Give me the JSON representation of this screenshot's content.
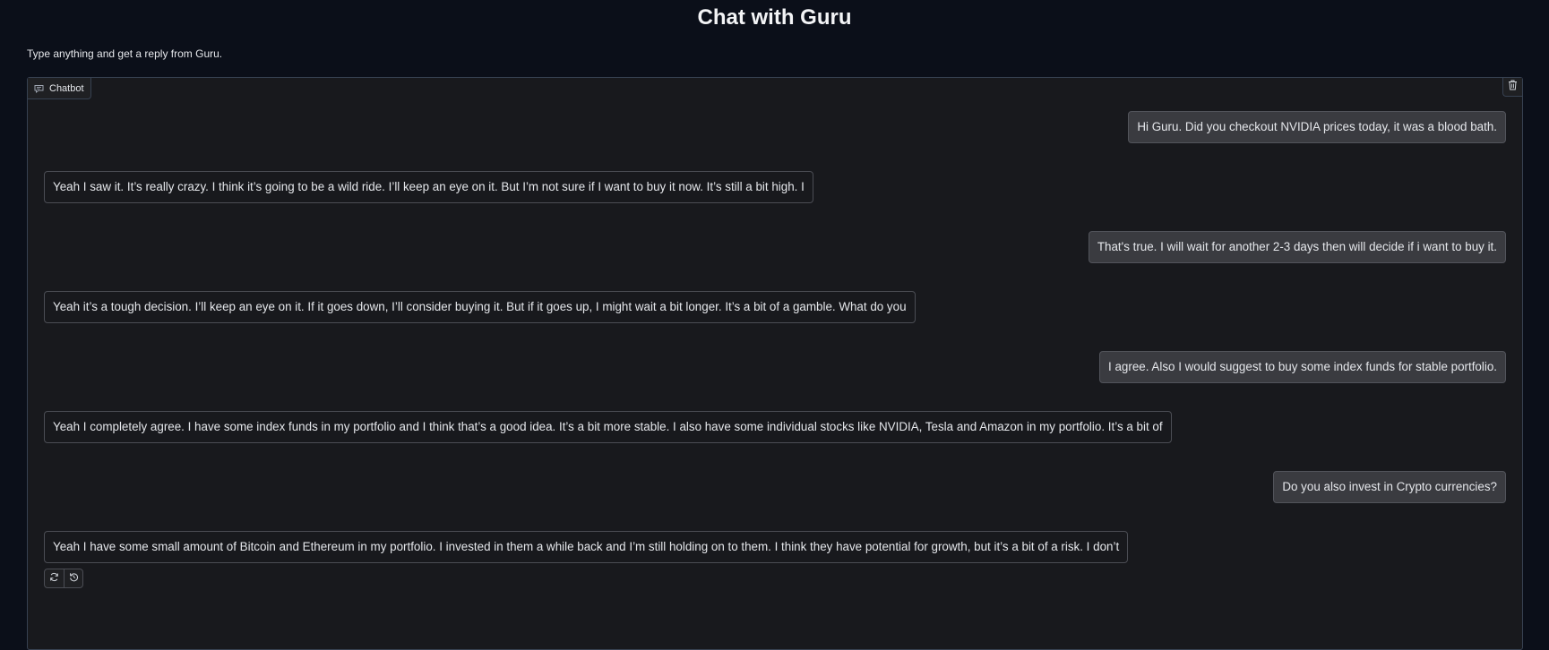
{
  "page": {
    "title": "Chat with Guru",
    "description": "Type anything and get a reply from Guru."
  },
  "chatbot": {
    "label": "Chatbot",
    "label_icon": "chat-bubble-icon",
    "clear_icon": "trash-icon",
    "messages": [
      {
        "role": "user",
        "text": "Hi Guru. Did you checkout NVIDIA prices today, it was a blood bath."
      },
      {
        "role": "bot",
        "text": "Yeah I saw it. It’s really crazy. I think it’s going to be a wild ride. I’ll keep an eye on it. But I’m not sure if I want to buy it now. It’s still a bit high. I"
      },
      {
        "role": "user",
        "text": "That's true. I will wait for another 2-3 days then will decide if i want to buy it."
      },
      {
        "role": "bot",
        "text": "Yeah it’s a tough decision. I’ll keep an eye on it. If it goes down, I’ll consider buying it. But if it goes up, I might wait a bit longer. It’s a bit of a gamble. What do you"
      },
      {
        "role": "user",
        "text": "I agree. Also I would suggest to buy some index funds for stable portfolio."
      },
      {
        "role": "bot",
        "text": "Yeah I completely agree. I have some index funds in my portfolio and I think that’s a good idea. It’s a bit more stable. I also have some individual stocks like NVIDIA, Tesla and Amazon in my portfolio. It’s a bit of"
      },
      {
        "role": "user",
        "text": "Do you also invest in Crypto currencies?"
      },
      {
        "role": "bot",
        "text": "Yeah I have some small amount of Bitcoin and Ethereum in my portfolio. I invested in them a while back and I’m still holding on to them. I think they have potential for growth, but it’s a bit of a risk. I don’t"
      }
    ],
    "actions": [
      {
        "name": "retry-button",
        "icon": "refresh-icon"
      },
      {
        "name": "undo-button",
        "icon": "undo-icon"
      }
    ]
  },
  "colors": {
    "page_background": "#0b0f19",
    "panel_background": "#18191d",
    "user_bubble": "#3a3b40",
    "border": "#374151"
  }
}
